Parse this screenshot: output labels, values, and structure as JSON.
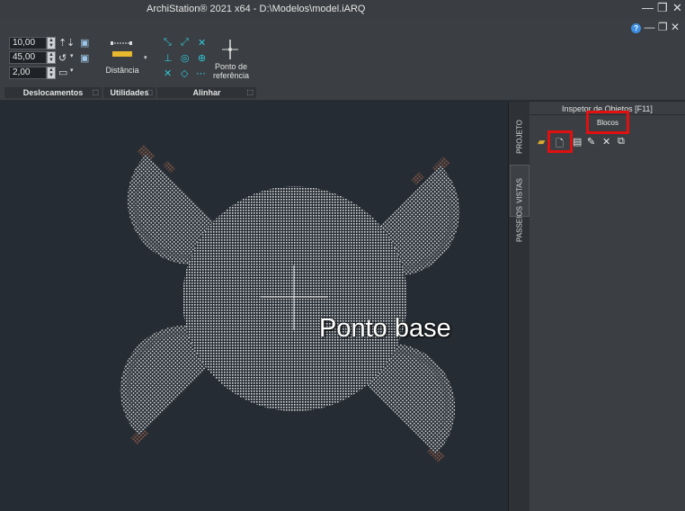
{
  "window": {
    "title": "ArchiStation® 2021 x64  - D:\\Modelos\\model.iARQ",
    "minimize": "—",
    "restore": "❐",
    "close": "✕"
  },
  "ribbon": {
    "help_icon": "help-icon",
    "inner_minimize": "—",
    "inner_restore": "❐",
    "inner_close": "✕",
    "inputs": [
      "10,00",
      "45,00",
      "2,00"
    ],
    "distance_label": "Distância",
    "reference_point_label": "Ponto de referência",
    "panels": [
      "Deslocamentos",
      "Utilidades",
      "Alinhar"
    ]
  },
  "side_tabs": [
    "PROJETO",
    "VISTAS",
    "PASSEIOS"
  ],
  "inspector": {
    "title": "Inspetor de Objetos [F11]",
    "tab": "Blocos",
    "toolbar_icons": [
      "folder-icon",
      "new-block-icon",
      "insert-block-icon",
      "edit-block-icon",
      "delete-icon",
      "explode-icon"
    ]
  },
  "canvas": {
    "annotation": "Ponto base"
  },
  "colors": {
    "canvas_bg": "#262c33",
    "highlight": "#e01010",
    "chair_leg": "#8a5a48"
  }
}
